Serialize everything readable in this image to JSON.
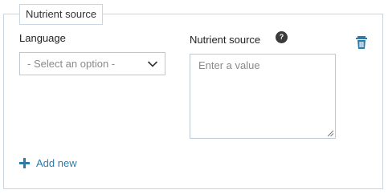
{
  "fieldset": {
    "legend": "Nutrient source"
  },
  "language": {
    "label": "Language",
    "placeholder": "- Select an option -"
  },
  "nutrient_source": {
    "label": "Nutrient source",
    "placeholder": "Enter a value",
    "help_icon": "?"
  },
  "actions": {
    "add_new_label": "Add new"
  },
  "icons": {
    "help": "question-circle-icon",
    "delete": "trash-icon",
    "dropdown": "chevron-down-icon",
    "add": "plus-icon"
  },
  "colors": {
    "accent": "#2f7ba8",
    "border": "#c9d6e1",
    "help_bg": "#3b3b3b"
  }
}
